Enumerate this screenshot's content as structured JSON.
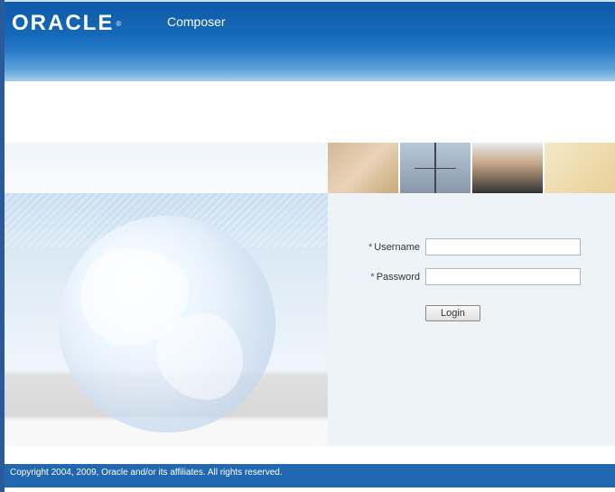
{
  "header": {
    "brand": "ORACLE",
    "registered": "®",
    "product": "Composer"
  },
  "form": {
    "username_label": "Username",
    "password_label": "Password",
    "required_mark": "*",
    "login_button": "Login"
  },
  "footer": {
    "copyright": "Copyright 2004, 2009, Oracle and/or its affiliates. All rights reserved."
  },
  "colors": {
    "header_gradient_top": "#0e5aa8",
    "header_gradient_bottom": "#a8cde8",
    "sidebar_border": "#2a5a9a",
    "form_bg": "#eef3f8",
    "footer_bg": "#2168b0"
  }
}
